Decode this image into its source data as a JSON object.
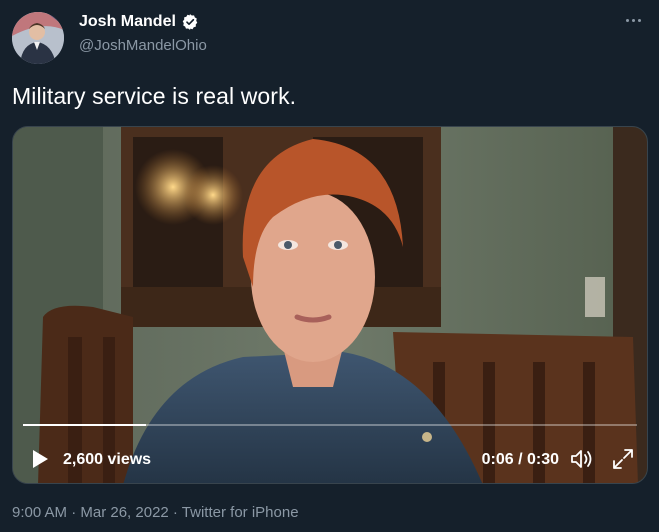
{
  "author": {
    "name": "Josh Mandel",
    "handle": "@JoshMandelOhio",
    "verified": true,
    "avatar_icon": "profile-photo"
  },
  "tweet": {
    "text": "Military service is real work."
  },
  "video": {
    "views": "2,600 views",
    "time": "0:06 / 0:30",
    "progress": 0.2
  },
  "footer": {
    "meta": "9:00 AM · Mar 26, 2022 · Twitter for iPhone"
  },
  "colors": {
    "background": "#15202b",
    "secondary_text": "#8b98a5",
    "verified_badge": "#ffffff"
  }
}
